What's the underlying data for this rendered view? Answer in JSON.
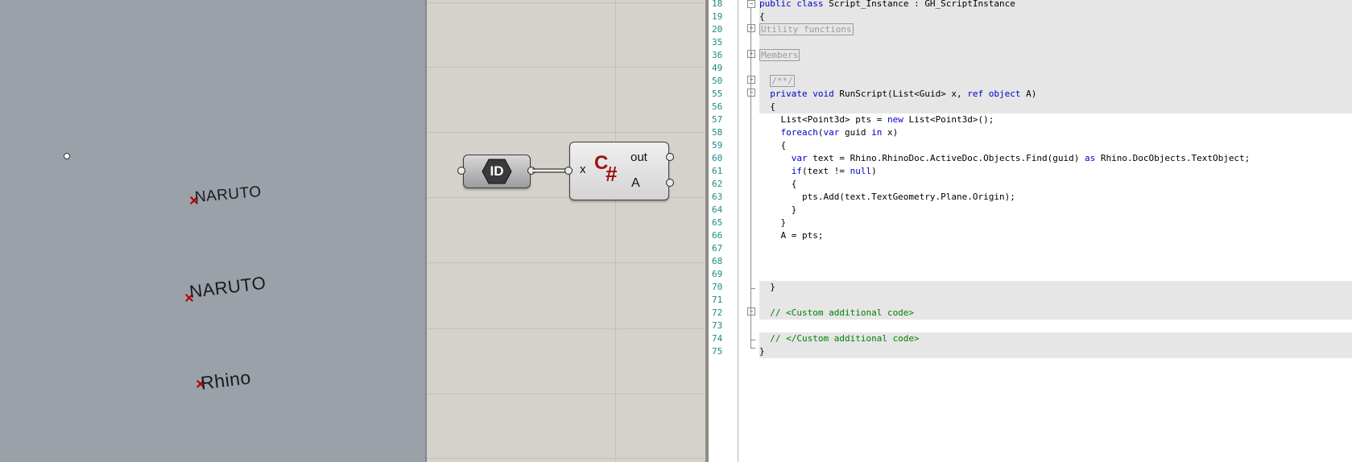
{
  "viewport": {
    "texts": [
      {
        "label": "NARUTO"
      },
      {
        "label": "NARUTO"
      },
      {
        "label": "Rhino"
      }
    ]
  },
  "grasshopper": {
    "id_component": {
      "label": "ID"
    },
    "script_component": {
      "input": "x",
      "outputs": [
        "out",
        "A"
      ],
      "logo": "C",
      "logo_hash": "#"
    }
  },
  "editor": {
    "lines": [
      {
        "n": "18",
        "text": "public class Script_Instance : GH_ScriptInstance"
      },
      {
        "n": "19",
        "text": "{"
      },
      {
        "n": "20",
        "text": "Utility functions"
      },
      {
        "n": "35",
        "text": ""
      },
      {
        "n": "36",
        "text": "Members"
      },
      {
        "n": "49",
        "text": ""
      },
      {
        "n": "50",
        "text": "/**/"
      },
      {
        "n": "55",
        "text": "  private void RunScript(List<Guid> x, ref object A)"
      },
      {
        "n": "56",
        "text": "  {"
      },
      {
        "n": "57",
        "text": "    List<Point3d> pts = new List<Point3d>();"
      },
      {
        "n": "58",
        "text": "    foreach(var guid in x)"
      },
      {
        "n": "59",
        "text": "    {"
      },
      {
        "n": "60",
        "text": "      var text = Rhino.RhinoDoc.ActiveDoc.Objects.Find(guid) as Rhino.DocObjects.TextObject;"
      },
      {
        "n": "61",
        "text": "      if(text != null)"
      },
      {
        "n": "62",
        "text": "      {"
      },
      {
        "n": "63",
        "text": "        pts.Add(text.TextGeometry.Plane.Origin);"
      },
      {
        "n": "64",
        "text": "      }"
      },
      {
        "n": "65",
        "text": "    }"
      },
      {
        "n": "66",
        "text": "    A = pts;"
      },
      {
        "n": "67",
        "text": ""
      },
      {
        "n": "68",
        "text": ""
      },
      {
        "n": "69",
        "text": ""
      },
      {
        "n": "70",
        "text": "  }"
      },
      {
        "n": "71",
        "text": ""
      },
      {
        "n": "72",
        "text": "  // <Custom additional code>"
      },
      {
        "n": "73",
        "text": ""
      },
      {
        "n": "74",
        "text": "  // </Custom additional code>"
      },
      {
        "n": "75",
        "text": "}"
      }
    ]
  },
  "colors": {
    "viewport_bg": "#9aa1a9",
    "canvas_bg": "#d5d1cb",
    "keyword": "#0000cc",
    "comment": "#008000",
    "line_number": "#1a8a8a",
    "point_marker": "#b30000"
  },
  "icons": {
    "fold_collapse": "minus-box-icon",
    "fold_expand": "plus-box-icon"
  }
}
